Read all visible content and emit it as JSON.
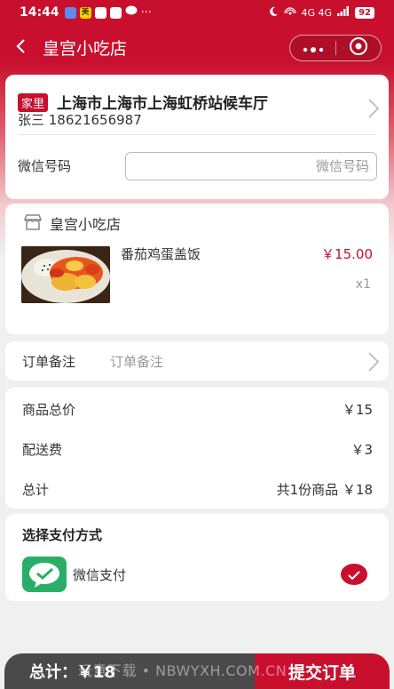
{
  "status_bar": {
    "time": "14:44",
    "more_dots": "···",
    "network": "4G 4G",
    "battery": "92"
  },
  "navbar": {
    "title": "皇宫小吃店"
  },
  "address": {
    "tag": "家里",
    "full": "上海市上海市上海虹桥站候车厅",
    "contact": "张三 18621656987",
    "wechat_label": "微信号码",
    "wechat_placeholder": "微信号码"
  },
  "shop": {
    "name": "皇宫小吃店",
    "item": {
      "name": "番茄鸡蛋盖饭",
      "price": "￥15.00",
      "qty": "x1"
    }
  },
  "note": {
    "label": "订单备注",
    "placeholder": "订单备注"
  },
  "summary": {
    "rows": [
      {
        "label": "商品总价",
        "value": "￥15"
      },
      {
        "label": "配送费",
        "value": "￥3"
      },
      {
        "label": "总计",
        "value": "共1份商品 ￥18"
      }
    ]
  },
  "payment": {
    "title": "选择支付方式",
    "method": "微信支付",
    "selected": true
  },
  "footer": {
    "total": "总计：￥18",
    "submit": "提交订单",
    "watermark": "玩意下载 • NBWYXH.COM.CN"
  },
  "colors": {
    "accent": "#c8102e",
    "wechat_green": "#2aae67"
  }
}
